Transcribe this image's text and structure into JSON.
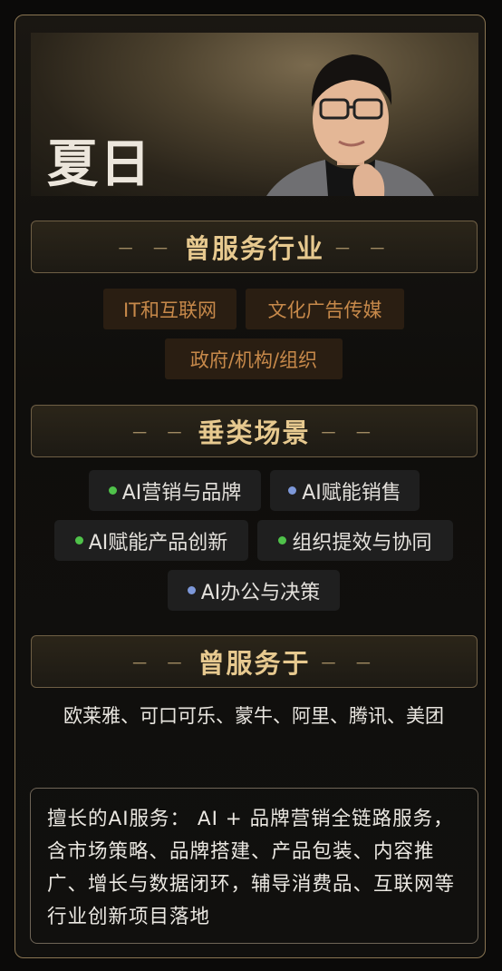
{
  "profile": {
    "name": "夏日"
  },
  "sections": {
    "industries": {
      "title": "曾服务行业",
      "dash": "－ －"
    },
    "scenarios": {
      "title": "垂类场景",
      "dash": "－ －"
    },
    "clients": {
      "title": "曾服务于",
      "dash": "－ －"
    }
  },
  "industries": [
    "IT和互联网",
    "文化广告传媒",
    "政府/机构/组织"
  ],
  "scenarios": [
    {
      "label": "AI营销与品牌",
      "dot_color": "#4fc24a"
    },
    {
      "label": "AI赋能销售",
      "dot_color": "#7d98d9"
    },
    {
      "label": "AI赋能产品创新",
      "dot_color": "#4fc24a"
    },
    {
      "label": "组织提效与协同",
      "dot_color": "#4fc24a"
    },
    {
      "label": "AI办公与决策",
      "dot_color": "#7d98d9"
    }
  ],
  "clients_text": "欧莱雅、可口可乐、蒙牛、阿里、腾讯、美团",
  "description": "擅长的AI服务： AI + 品牌营销全链路服务，含市场策略、品牌搭建、产品包装、内容推广、增长与数据闭环，辅导消费品、互联网等行业创新项目落地",
  "colors": {
    "accent_gold": "#e7c98f",
    "industry_text": "#c7894a",
    "border": "#8a7552"
  }
}
